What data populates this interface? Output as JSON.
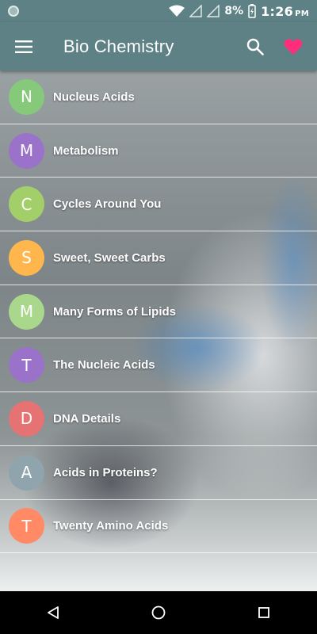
{
  "status_bar": {
    "battery_percent": "8%",
    "time": "1:26",
    "am_pm": "PM"
  },
  "app_bar": {
    "title": "Bio Chemistry",
    "icons": [
      "menu-icon",
      "search-icon",
      "heart-icon"
    ],
    "favorite_color": "#ff2d7a"
  },
  "topics": [
    {
      "letter": "N",
      "label": "Nucleus Acids",
      "color": "#86c97a"
    },
    {
      "letter": "M",
      "label": "Metabolism",
      "color": "#9a72c9"
    },
    {
      "letter": "C",
      "label": "Cycles Around You",
      "color": "#a3cf6a"
    },
    {
      "letter": "S",
      "label": "Sweet, Sweet Carbs",
      "color": "#ffb74d"
    },
    {
      "letter": "M",
      "label": "Many Forms of Lipids",
      "color": "#a9d88c"
    },
    {
      "letter": "T",
      "label": "The Nucleic Acids",
      "color": "#9a72c9"
    },
    {
      "letter": "D",
      "label": "DNA Details",
      "color": "#e57373"
    },
    {
      "letter": "A",
      "label": "Acids in Proteins?",
      "color": "#8fa4ad"
    },
    {
      "letter": "T",
      "label": "Twenty Amino Acids",
      "color": "#ff8a65"
    }
  ],
  "nav_bar": {
    "icons": [
      "back-icon",
      "home-icon",
      "recents-icon"
    ]
  }
}
